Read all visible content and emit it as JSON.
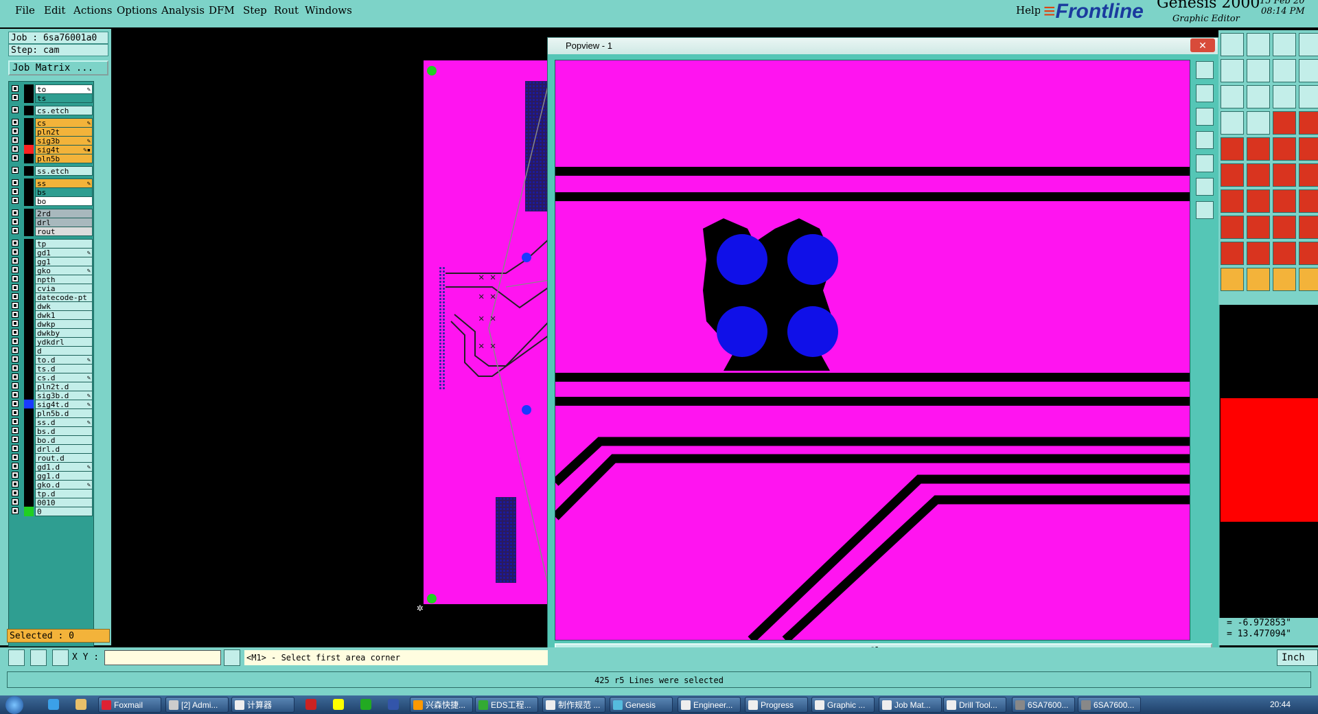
{
  "menu": [
    "File",
    "Edit",
    "Actions",
    "Options",
    "Analysis",
    "DFM",
    "Step",
    "Rout",
    "Windows"
  ],
  "help": "Help",
  "brand": {
    "logo_a": "≡",
    "logo_b": "Frontline",
    "product": "Genesis 2000",
    "subtitle": "Graphic Editor",
    "date": "15 Feb 20",
    "time": "08:14 PM"
  },
  "info": {
    "job": "Job : 6sa76001a0",
    "step": "Step: cam",
    "job_matrix": "Job Matrix ..."
  },
  "layers": [
    {
      "name": "to",
      "bg": "#ffffff",
      "swatch": "#000000",
      "edit": "✎",
      "group": 0
    },
    {
      "name": "ts",
      "bg": "#2f9e91",
      "swatch": "#000000",
      "edit": "",
      "group": 0
    },
    {
      "name": "cs.etch",
      "bg": "#c3eee9",
      "swatch": "#000000",
      "edit": "",
      "group": 1
    },
    {
      "name": "cs",
      "bg": "#f3b33a",
      "swatch": "#000000",
      "edit": "✎",
      "group": 2
    },
    {
      "name": "pln2t",
      "bg": "#f3b33a",
      "swatch": "#000000",
      "edit": "",
      "group": 2
    },
    {
      "name": "sig3b",
      "bg": "#f3b33a",
      "swatch": "#000000",
      "edit": "✎",
      "group": 2
    },
    {
      "name": "sig4t",
      "bg": "#f3b33a",
      "swatch": "#ff2020",
      "edit": "✎▪",
      "group": 2
    },
    {
      "name": "pln5b",
      "bg": "#f3b33a",
      "swatch": "#000000",
      "edit": "",
      "group": 2
    },
    {
      "name": "ss.etch",
      "bg": "#c3eee9",
      "swatch": "#000000",
      "edit": "",
      "group": 3
    },
    {
      "name": "ss",
      "bg": "#f3b33a",
      "swatch": "#000000",
      "edit": "✎",
      "group": 4
    },
    {
      "name": "bs",
      "bg": "#2f9e91",
      "swatch": "#000000",
      "edit": "",
      "group": 4
    },
    {
      "name": "bo",
      "bg": "#ffffff",
      "swatch": "#000000",
      "edit": "",
      "group": 4
    },
    {
      "name": "2rd",
      "bg": "#a8b8bd",
      "swatch": "#000000",
      "edit": "",
      "group": 5
    },
    {
      "name": "drl",
      "bg": "#a8b8bd",
      "swatch": "#000000",
      "edit": "",
      "group": 5
    },
    {
      "name": "rout",
      "bg": "#dcdcdc",
      "swatch": "#000000",
      "edit": "",
      "group": 5
    },
    {
      "name": "tp",
      "bg": "#c3eee9",
      "swatch": "#000000",
      "edit": "",
      "group": 6
    },
    {
      "name": "gd1",
      "bg": "#c3eee9",
      "swatch": "#000000",
      "edit": "✎",
      "group": 6
    },
    {
      "name": "gg1",
      "bg": "#c3eee9",
      "swatch": "#000000",
      "edit": "",
      "group": 6
    },
    {
      "name": "gko",
      "bg": "#c3eee9",
      "swatch": "#000000",
      "edit": "✎",
      "group": 6
    },
    {
      "name": "npth",
      "bg": "#c3eee9",
      "swatch": "#000000",
      "edit": "",
      "group": 6
    },
    {
      "name": "cvia",
      "bg": "#c3eee9",
      "swatch": "#000000",
      "edit": "",
      "group": 6
    },
    {
      "name": "datecode-pt",
      "bg": "#c3eee9",
      "swatch": "#000000",
      "edit": "",
      "group": 6
    },
    {
      "name": "dwk",
      "bg": "#c3eee9",
      "swatch": "#000000",
      "edit": "",
      "group": 6
    },
    {
      "name": "dwk1",
      "bg": "#c3eee9",
      "swatch": "#000000",
      "edit": "",
      "group": 6
    },
    {
      "name": "dwkp",
      "bg": "#c3eee9",
      "swatch": "#000000",
      "edit": "",
      "group": 6
    },
    {
      "name": "dwkby",
      "bg": "#c3eee9",
      "swatch": "#000000",
      "edit": "",
      "group": 6
    },
    {
      "name": "ydkdrl",
      "bg": "#c3eee9",
      "swatch": "#000000",
      "edit": "",
      "group": 6
    },
    {
      "name": "d",
      "bg": "#c3eee9",
      "swatch": "#000000",
      "edit": "",
      "group": 6
    },
    {
      "name": "to.d",
      "bg": "#c3eee9",
      "swatch": "#000000",
      "edit": "✎",
      "group": 6
    },
    {
      "name": "ts.d",
      "bg": "#c3eee9",
      "swatch": "#000000",
      "edit": "",
      "group": 6
    },
    {
      "name": "cs.d",
      "bg": "#c3eee9",
      "swatch": "#000000",
      "edit": "✎",
      "group": 6
    },
    {
      "name": "pln2t.d",
      "bg": "#c3eee9",
      "swatch": "#000000",
      "edit": "",
      "group": 6
    },
    {
      "name": "sig3b.d",
      "bg": "#c3eee9",
      "swatch": "#000000",
      "edit": "✎",
      "group": 6
    },
    {
      "name": "sig4t.d",
      "bg": "#c3eee9",
      "swatch": "#1a3aff",
      "edit": "✎",
      "group": 6
    },
    {
      "name": "pln5b.d",
      "bg": "#c3eee9",
      "swatch": "#000000",
      "edit": "",
      "group": 6
    },
    {
      "name": "ss.d",
      "bg": "#c3eee9",
      "swatch": "#000000",
      "edit": "✎",
      "group": 6
    },
    {
      "name": "bs.d",
      "bg": "#c3eee9",
      "swatch": "#000000",
      "edit": "",
      "group": 6
    },
    {
      "name": "bo.d",
      "bg": "#c3eee9",
      "swatch": "#000000",
      "edit": "",
      "group": 6
    },
    {
      "name": "drl.d",
      "bg": "#c3eee9",
      "swatch": "#000000",
      "edit": "",
      "group": 6
    },
    {
      "name": "rout.d",
      "bg": "#c3eee9",
      "swatch": "#000000",
      "edit": "",
      "group": 6
    },
    {
      "name": "gd1.d",
      "bg": "#c3eee9",
      "swatch": "#000000",
      "edit": "✎",
      "group": 6
    },
    {
      "name": "gg1.d",
      "bg": "#c3eee9",
      "swatch": "#000000",
      "edit": "",
      "group": 6
    },
    {
      "name": "gko.d",
      "bg": "#c3eee9",
      "swatch": "#000000",
      "edit": "✎",
      "group": 6
    },
    {
      "name": "tp.d",
      "bg": "#c3eee9",
      "swatch": "#000000",
      "edit": "",
      "group": 6
    },
    {
      "name": "0010",
      "bg": "#c3eee9",
      "swatch": "#000000",
      "edit": "",
      "group": 6
    },
    {
      "name": "0",
      "bg": "#c3eee9",
      "swatch": "#20d020",
      "edit": "",
      "group": 6
    }
  ],
  "selected": "Selected : 0",
  "popview": {
    "title": "Popview - 1",
    "close_x": "✕",
    "close_button": "Close"
  },
  "coords": {
    "x": "= -6.972853\"",
    "y": "= 13.477094\""
  },
  "cmd": {
    "xy_label": "X Y :",
    "xy_value": "",
    "prompt": "<M1> - Select first area corner",
    "unit": "Inch"
  },
  "status": "425 r5 Lines were selected",
  "taskbar": {
    "items": [
      {
        "label": "Foxmail",
        "icon": "#d23"
      },
      {
        "label": "[2] Admi...",
        "icon": "#ccc"
      },
      {
        "label": "计算器",
        "icon": "#eee"
      },
      {
        "label": "兴森快捷...",
        "icon": "#f90"
      },
      {
        "label": "EDS工程...",
        "icon": "#3a3"
      },
      {
        "label": "制作规范 ...",
        "icon": "#eee"
      },
      {
        "label": "Genesis",
        "icon": "#5bd"
      },
      {
        "label": "Engineer...",
        "icon": "#eee"
      },
      {
        "label": "Progress",
        "icon": "#eee"
      },
      {
        "label": "Graphic ...",
        "icon": "#eee"
      },
      {
        "label": "Job Mat...",
        "icon": "#eee"
      },
      {
        "label": "Drill Tool...",
        "icon": "#eee"
      },
      {
        "label": "6SA7600...",
        "icon": "#888"
      },
      {
        "label": "6SA7600...",
        "icon": "#888"
      }
    ],
    "clock": "20:44"
  }
}
